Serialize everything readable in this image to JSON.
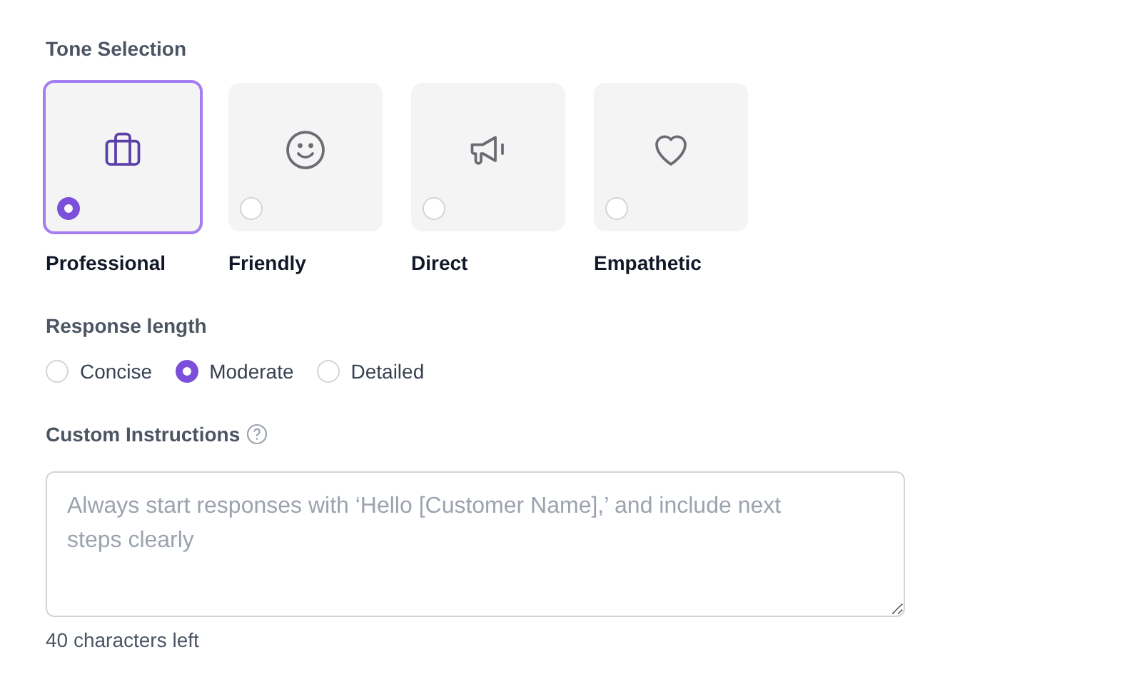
{
  "tone_section": {
    "title": "Tone Selection",
    "options": [
      {
        "label": "Professional",
        "kind": "briefcase",
        "selected": true
      },
      {
        "label": "Friendly",
        "kind": "smile",
        "selected": false
      },
      {
        "label": "Direct",
        "kind": "megaphone",
        "selected": false
      },
      {
        "label": "Empathetic",
        "kind": "heart",
        "selected": false
      }
    ]
  },
  "length_section": {
    "title": "Response length",
    "options": [
      {
        "label": "Concise",
        "selected": false
      },
      {
        "label": "Moderate",
        "selected": true
      },
      {
        "label": "Detailed",
        "selected": false
      }
    ]
  },
  "instructions_section": {
    "title": "Custom Instructions",
    "placeholder": "Always start responses with ‘Hello [Customer Name],’ and include next steps clearly",
    "counter": "40 characters left"
  }
}
